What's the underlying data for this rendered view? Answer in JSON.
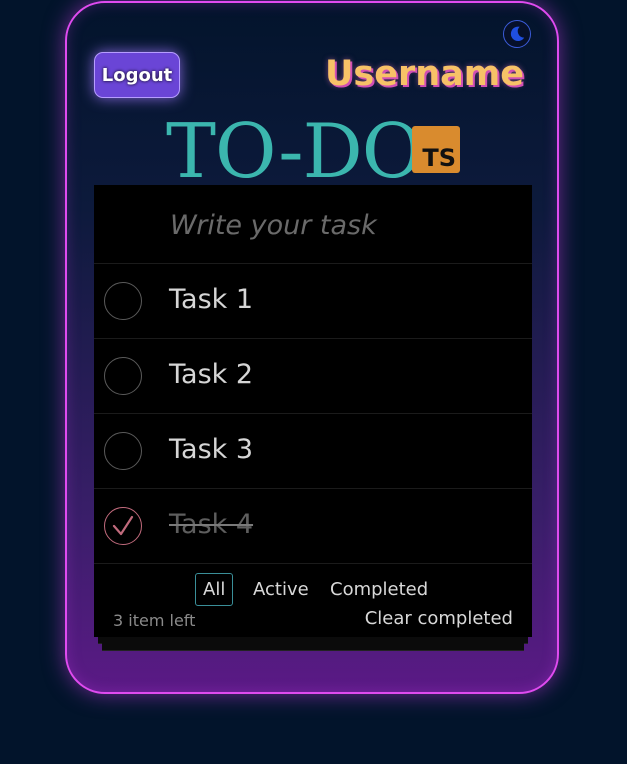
{
  "header": {
    "logout_label": "Logout",
    "username": "Username",
    "title": "TO-DO",
    "badge": "TS",
    "theme_icon": "moon-icon"
  },
  "new_task": {
    "placeholder": "Write your task",
    "value": ""
  },
  "tasks": [
    {
      "label": "Task 1",
      "completed": false
    },
    {
      "label": "Task 2",
      "completed": false
    },
    {
      "label": "Task 3",
      "completed": false
    },
    {
      "label": "Task 4",
      "completed": true
    }
  ],
  "footer": {
    "filters": [
      {
        "label": "All",
        "selected": true
      },
      {
        "label": "Active",
        "selected": false
      },
      {
        "label": "Completed",
        "selected": false
      }
    ],
    "items_left": "3 item left",
    "clear_label": "Clear completed"
  },
  "colors": {
    "background": "#02142b",
    "card_border": "#e04bf0",
    "title": "#3bb6ae",
    "badge": "#d98b2e",
    "username": "#f7c267",
    "logout_bg": "#6a45d6",
    "done_check": "#c06a7c",
    "selected_filter_border": "#3a8f99"
  }
}
